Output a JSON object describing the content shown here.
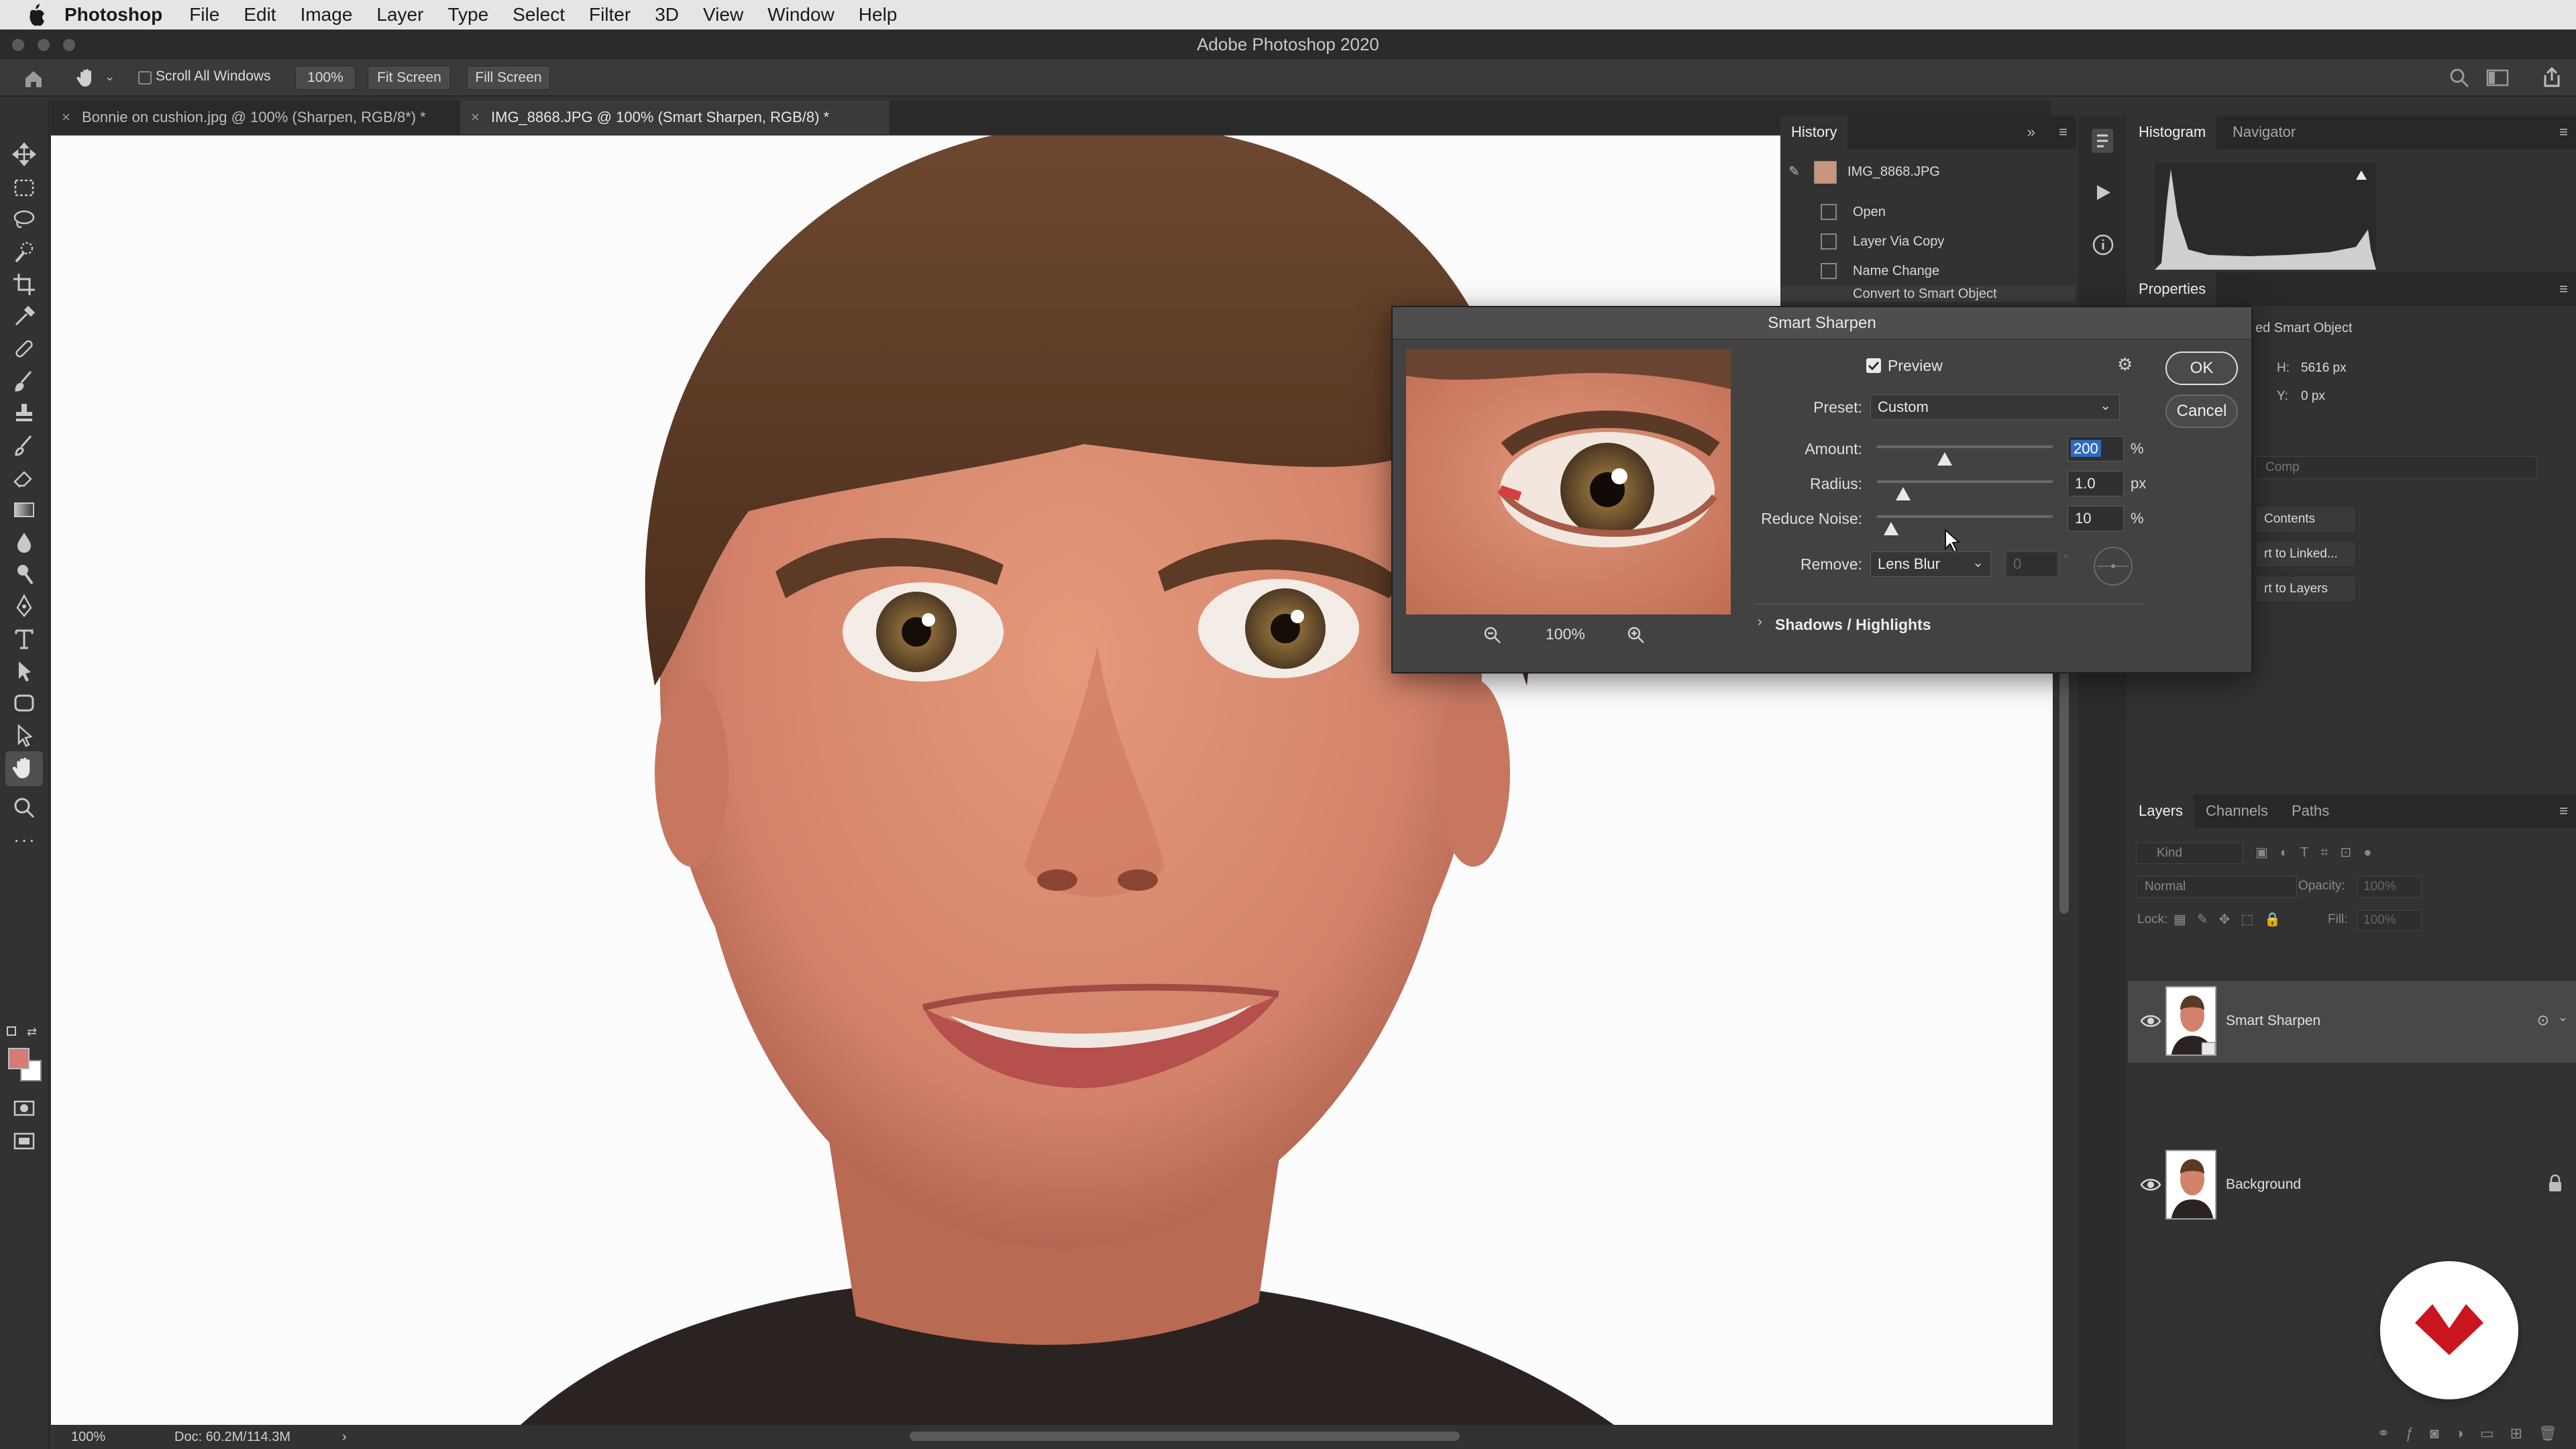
{
  "menubar": {
    "app": "Photoshop",
    "items": [
      "File",
      "Edit",
      "Image",
      "Layer",
      "Type",
      "Select",
      "Filter",
      "3D",
      "View",
      "Window",
      "Help"
    ]
  },
  "window": {
    "title": "Adobe Photoshop 2020"
  },
  "options": {
    "scroll_all": "Scroll All Windows",
    "zoom": "100%",
    "fit": "Fit Screen",
    "fill": "Fill Screen"
  },
  "tabs": [
    {
      "label": "Bonnie on cushion.jpg @ 100% (Sharpen, RGB/8*) *"
    },
    {
      "label": "IMG_8868.JPG @ 100% (Smart Sharpen, RGB/8) *"
    }
  ],
  "status": {
    "zoom": "100%",
    "doc": "Doc: 60.2M/114.3M",
    "arrow": "›"
  },
  "history": {
    "title": "History",
    "snapshot": "IMG_8868.JPG",
    "items": [
      "Open",
      "Layer Via Copy",
      "Name Change",
      "Convert to Smart Object"
    ]
  },
  "histogram": {
    "tab1": "Histogram",
    "tab2": "Navigator"
  },
  "properties": {
    "title": "Properties",
    "type": "ed Smart Object",
    "h_label": "H:",
    "h_value": "5616 px",
    "y_label": "Y:",
    "y_value": "0 px",
    "comp": "Comp",
    "btn1": "Contents",
    "btn2": "rt to Linked...",
    "btn3": "rt to Layers"
  },
  "dialog": {
    "title": "Smart Sharpen",
    "preview_label": "Preview",
    "preview_checked": true,
    "zoom": "100%",
    "preset_label": "Preset:",
    "preset_value": "Custom",
    "amount_label": "Amount:",
    "amount_value": "200",
    "amount_unit": "%",
    "radius_label": "Radius:",
    "radius_value": "1.0",
    "radius_unit": "px",
    "noise_label": "Reduce Noise:",
    "noise_value": "10",
    "noise_unit": "%",
    "remove_label": "Remove:",
    "remove_value": "Lens Blur",
    "angle_value": "0",
    "angle_unit": "°",
    "shadows_label": "Shadows / Highlights",
    "ok": "OK",
    "cancel": "Cancel"
  },
  "layers": {
    "tabs": [
      "Layers",
      "Channels",
      "Paths"
    ],
    "kind": "Kind",
    "blend": "Normal",
    "opacity_label": "Opacity:",
    "opacity_value": "100%",
    "lock_label": "Lock:",
    "fill_label": "Fill:",
    "fill_value": "100%",
    "items": [
      {
        "name": "Smart Sharpen"
      },
      {
        "name": "Background"
      }
    ]
  },
  "colors": {
    "accent": "#c9161e",
    "selection": "#2f6bc2",
    "skin": "#d58a6c",
    "hair": "#5a3a24"
  }
}
